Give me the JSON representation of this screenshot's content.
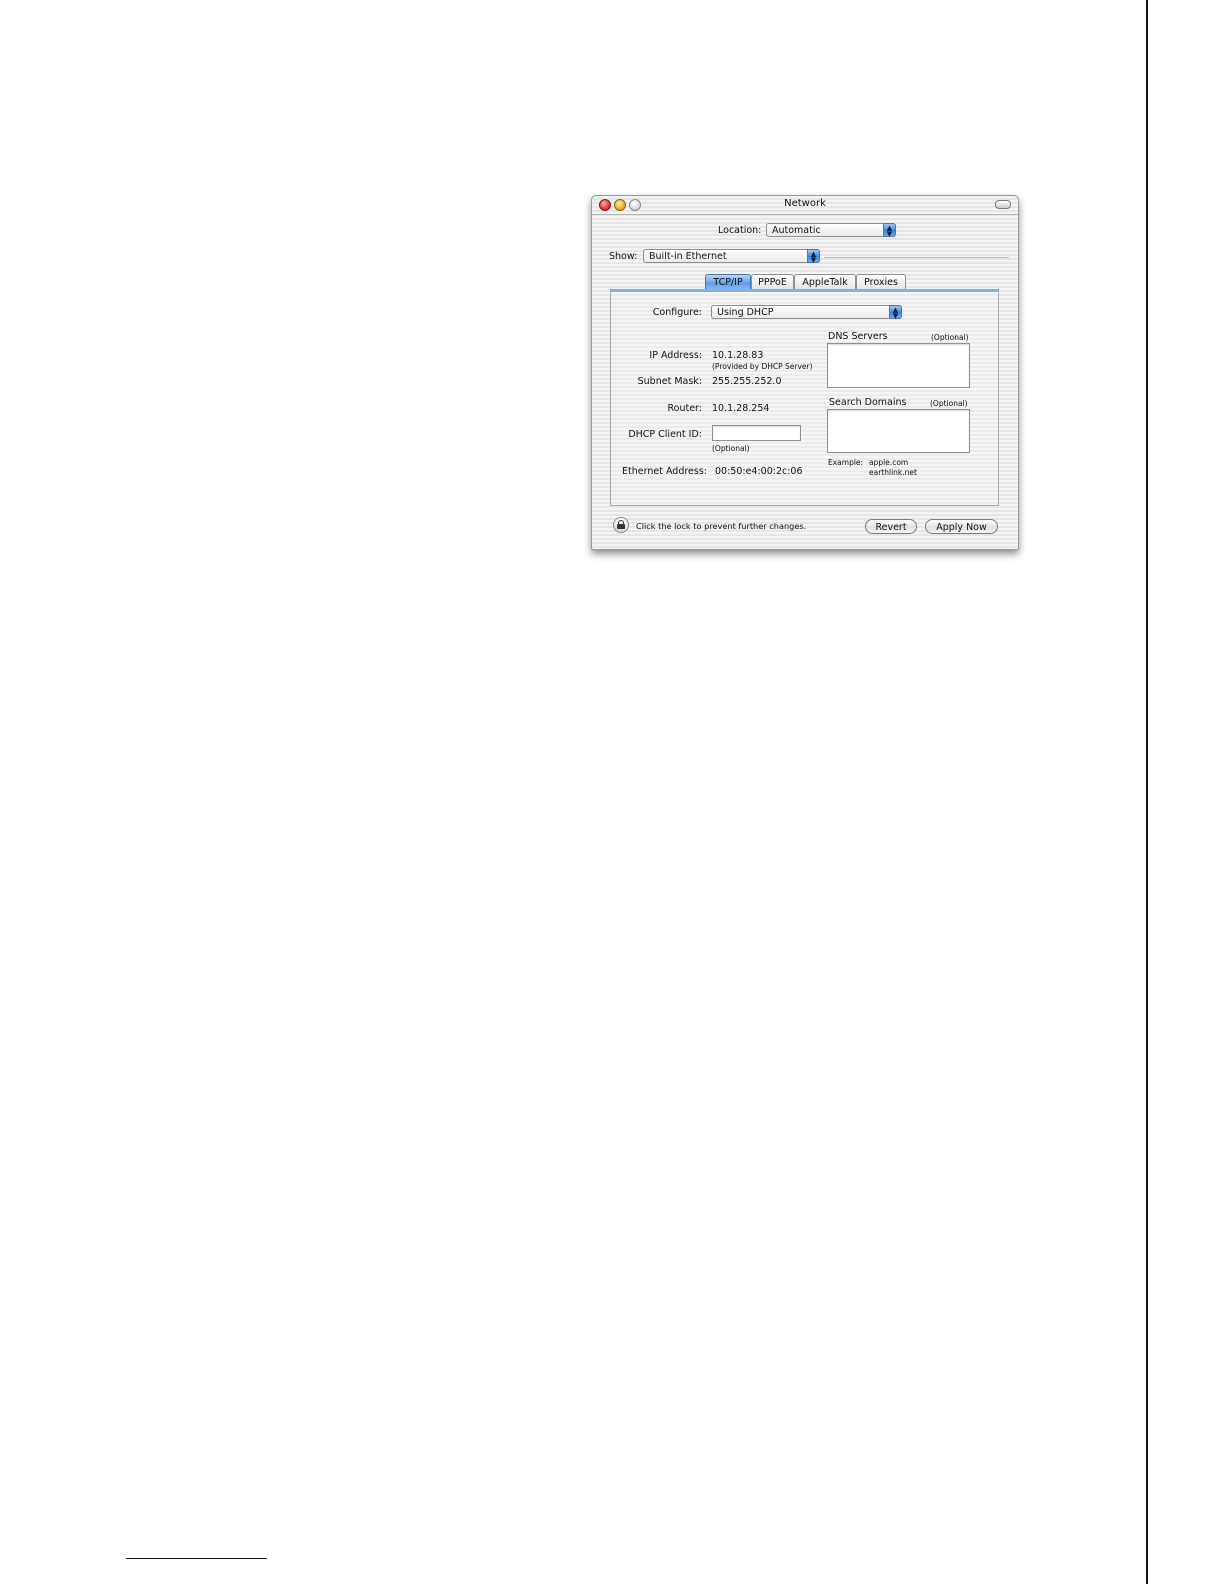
{
  "window": {
    "title": "Network"
  },
  "location": {
    "label": "Location:",
    "value": "Automatic"
  },
  "show": {
    "label": "Show:",
    "value": "Built-in Ethernet"
  },
  "tabs": [
    {
      "label": "TCP/IP",
      "selected": true
    },
    {
      "label": "PPPoE",
      "selected": false
    },
    {
      "label": "AppleTalk",
      "selected": false
    },
    {
      "label": "Proxies",
      "selected": false
    }
  ],
  "tcpip": {
    "configure_label": "Configure:",
    "configure_value": "Using DHCP",
    "ip_label": "IP Address:",
    "ip_value": "10.1.28.83",
    "ip_note": "(Provided by DHCP Server)",
    "subnet_label": "Subnet Mask:",
    "subnet_value": "255.255.252.0",
    "router_label": "Router:",
    "router_value": "10.1.28.254",
    "dhcp_client_label": "DHCP Client ID:",
    "dhcp_client_value": "",
    "dhcp_client_note": "(Optional)",
    "ethernet_label": "Ethernet Address:",
    "ethernet_value": "00:50:e4:00:2c:06",
    "dns_label": "DNS Servers",
    "dns_optional": "(Optional)",
    "search_label": "Search Domains",
    "search_optional": "(Optional)",
    "example_label": "Example:",
    "example_line1": "apple.com",
    "example_line2": "earthlink.net"
  },
  "footer": {
    "lock_text": "Click the lock to prevent further changes.",
    "revert_label": "Revert",
    "apply_label": "Apply Now"
  },
  "colors": {
    "accent": "#5f9ee8",
    "close": "#e0443a",
    "minimize": "#f0b62a"
  }
}
